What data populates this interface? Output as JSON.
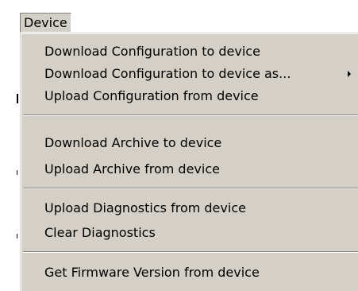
{
  "menubar": {
    "device_label": "Device"
  },
  "menu": {
    "group1": [
      {
        "label": "Download Configuration to device",
        "has_submenu": false
      },
      {
        "label": "Download Configuration to device as...",
        "has_submenu": true
      },
      {
        "label": "Upload Configuration from device",
        "has_submenu": false
      }
    ],
    "group2": [
      {
        "label": "Download Archive to device"
      },
      {
        "label": "Upload Archive from device"
      }
    ],
    "group3": [
      {
        "label": "Upload Diagnostics from device"
      },
      {
        "label": "Clear Diagnostics"
      }
    ],
    "group4": [
      {
        "label": "Get Firmware Version from device"
      }
    ]
  },
  "colors": {
    "menu_background": "#d4d0c8",
    "text": "#000000",
    "separator_dark": "#808080",
    "separator_light": "#ffffff"
  },
  "icons": {
    "submenu_arrow": "submenu-arrow-icon"
  }
}
